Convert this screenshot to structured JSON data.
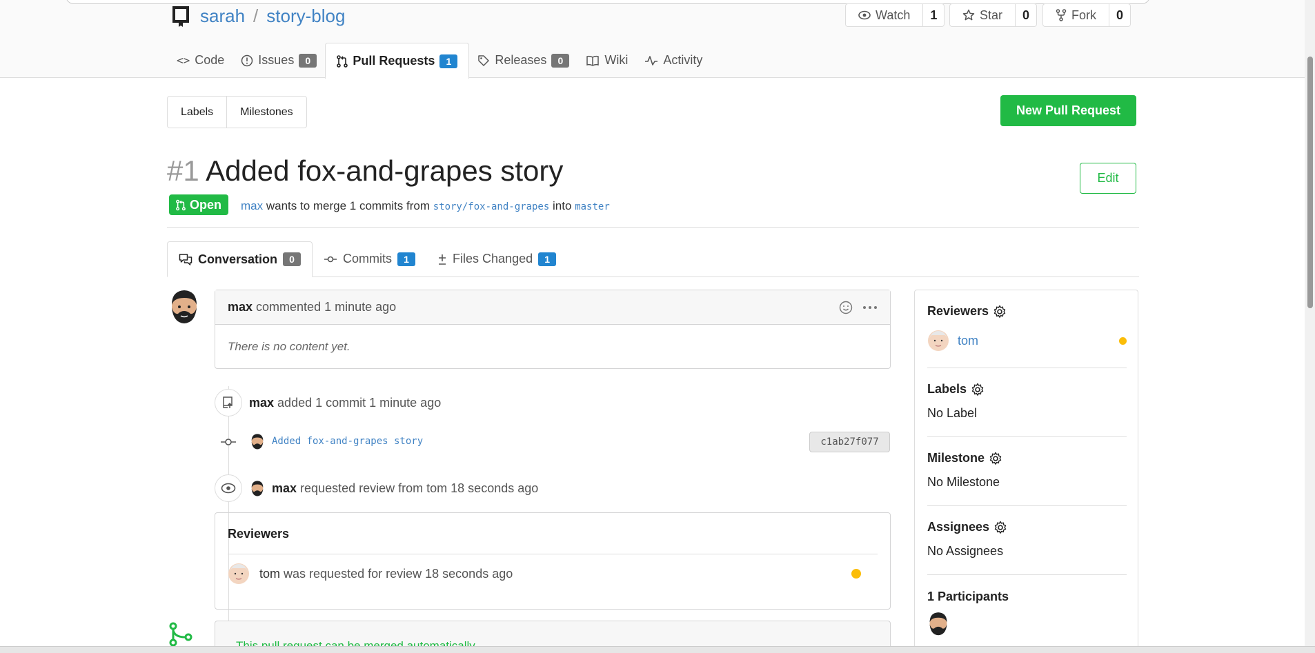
{
  "repo": {
    "owner": "sarah",
    "separator": "/",
    "name": "story-blog"
  },
  "repo_actions": [
    {
      "label": "Watch",
      "count": "1",
      "icon": "eye-icon"
    },
    {
      "label": "Star",
      "count": "0",
      "icon": "star-icon"
    },
    {
      "label": "Fork",
      "count": "0",
      "icon": "fork-icon"
    }
  ],
  "tabs": [
    {
      "label": "Code",
      "icon": "code-icon"
    },
    {
      "label": "Issues",
      "badge": "0",
      "icon": "issue-icon"
    },
    {
      "label": "Pull Requests",
      "badge": "1",
      "icon": "pull-request-icon",
      "active": true
    },
    {
      "label": "Releases",
      "badge": "0",
      "icon": "tag-icon"
    },
    {
      "label": "Wiki",
      "icon": "book-icon"
    },
    {
      "label": "Activity",
      "icon": "pulse-icon"
    }
  ],
  "subnav": {
    "labels": "Labels",
    "milestones": "Milestones"
  },
  "new_pr_label": "New Pull Request",
  "pr": {
    "number": "#1",
    "title": "Added fox-and-grapes story",
    "edit_label": "Edit",
    "status": "Open",
    "author": "max",
    "merge_text_1": "wants to merge 1 commits from",
    "head_branch": "story/fox-and-grapes",
    "merge_text_2": "into",
    "base_branch": "master"
  },
  "conv_tabs": [
    {
      "label": "Conversation",
      "badge": "0",
      "icon": "comment-discussion-icon"
    },
    {
      "label": "Commits",
      "badge": "1",
      "icon": "commit-icon"
    },
    {
      "label": "Files Changed",
      "badge": "1",
      "icon": "diff-icon"
    }
  ],
  "comment": {
    "author": "max",
    "verb": "commented",
    "time": "1 minute ago",
    "body": "There is no content yet."
  },
  "events": {
    "push": {
      "author": "max",
      "text": "added 1 commit",
      "time": "1 minute ago"
    },
    "commit": {
      "message": "Added fox-and-grapes story",
      "sha": "c1ab27f077"
    },
    "review_request": {
      "author": "max",
      "text": "requested review from tom",
      "time": "18 seconds ago"
    }
  },
  "reviewers_box": {
    "title": "Reviewers",
    "reviewer": "tom",
    "text": "was requested for review",
    "time": "18 seconds ago"
  },
  "merge_box": {
    "text": "This pull request can be merged automatically."
  },
  "sidebar": {
    "reviewers_title": "Reviewers",
    "reviewer": "tom",
    "labels_title": "Labels",
    "labels_value": "No Label",
    "milestone_title": "Milestone",
    "milestone_value": "No Milestone",
    "assignees_title": "Assignees",
    "assignees_value": "No Assignees",
    "participants_title": "1 Participants"
  },
  "colors": {
    "green": "#21ba45",
    "blue": "#2185d0",
    "link": "#4183c4",
    "pending": "#fbbd08"
  }
}
